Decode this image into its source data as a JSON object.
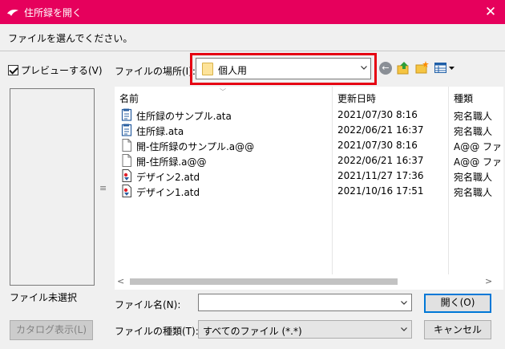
{
  "window": {
    "title": "住所録を開く"
  },
  "instruction": "ファイルを選んでください。",
  "preview": {
    "checkbox_label": "プレビューする(V)",
    "checked": true,
    "no_file_text": "ファイル未選択",
    "catalog_button": "カタログ表示(L)"
  },
  "look_in": {
    "label": "ファイルの場所(I):",
    "value": "個人用"
  },
  "columns": {
    "name": "名前",
    "date": "更新日時",
    "type": "種類"
  },
  "files": [
    {
      "name": "住所録のサンプル.ata",
      "date": "2021/07/30 8:16",
      "type": "宛名職人",
      "icon": "address-book-icon"
    },
    {
      "name": "住所録.ata",
      "date": "2022/06/21 16:37",
      "type": "宛名職人",
      "icon": "address-book-icon"
    },
    {
      "name": "開-住所録のサンプル.a@@",
      "date": "2021/07/30 8:16",
      "type": "A@@ ファ",
      "icon": "blank-file-icon"
    },
    {
      "name": "開-住所録.a@@",
      "date": "2022/06/21 16:37",
      "type": "A@@ ファ",
      "icon": "blank-file-icon"
    },
    {
      "name": "デザイン2.atd",
      "date": "2021/11/27 17:36",
      "type": "宛名職人",
      "icon": "design-file-icon"
    },
    {
      "name": "デザイン1.atd",
      "date": "2021/10/16 17:51",
      "type": "宛名職人",
      "icon": "design-file-icon"
    }
  ],
  "file_name": {
    "label": "ファイル名(N):",
    "value": ""
  },
  "file_type": {
    "label": "ファイルの種類(T):",
    "value": "すべてのファイル (*.*)"
  },
  "buttons": {
    "open": "開く(O)",
    "cancel": "キャンセル"
  },
  "colors": {
    "titlebar": "#e6005c",
    "highlight_box": "#e60012",
    "accent": "#0078d7"
  }
}
